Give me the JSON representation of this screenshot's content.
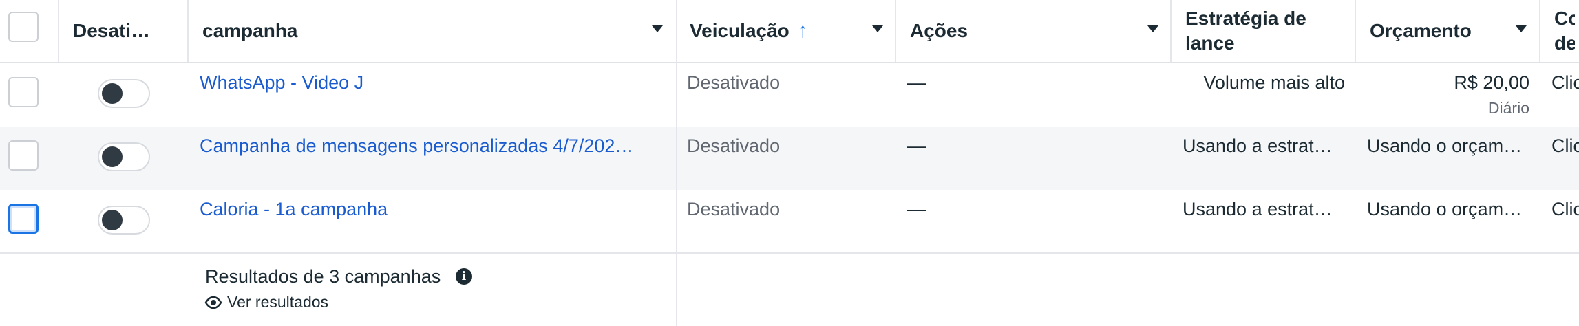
{
  "columns": {
    "status": "Desati…",
    "campaign": "campanha",
    "delivery": "Veiculação",
    "sort_arrow": "↑",
    "actions": "Ações",
    "bid_strategy": "Estratégia de lance",
    "budget": "Orçamento",
    "next": "Co de"
  },
  "rows": [
    {
      "name": "WhatsApp - Video J",
      "delivery": "Desativado",
      "actions": "—",
      "bid": "Volume mais alto",
      "budget": "R$ 20,00",
      "budget_sub": "Diário",
      "next": "Clic"
    },
    {
      "name": "Campanha de mensagens personalizadas 4/7/202…",
      "delivery": "Desativado",
      "actions": "—",
      "bid": "Usando a estrat…",
      "budget": "Usando o orçam…",
      "next": "Clic"
    },
    {
      "name": "Caloria - 1a campanha",
      "delivery": "Desativado",
      "actions": "—",
      "bid": "Usando a estrat…",
      "budget": "Usando o orçam…",
      "next": "Clic"
    }
  ],
  "footer": {
    "results": "Resultados de 3 campanhas",
    "view_results": "Ver resultados"
  },
  "colors": {
    "link": "#1a5ccf",
    "sort_arrow": "#1b74e4",
    "focus": "#1b74e4"
  }
}
